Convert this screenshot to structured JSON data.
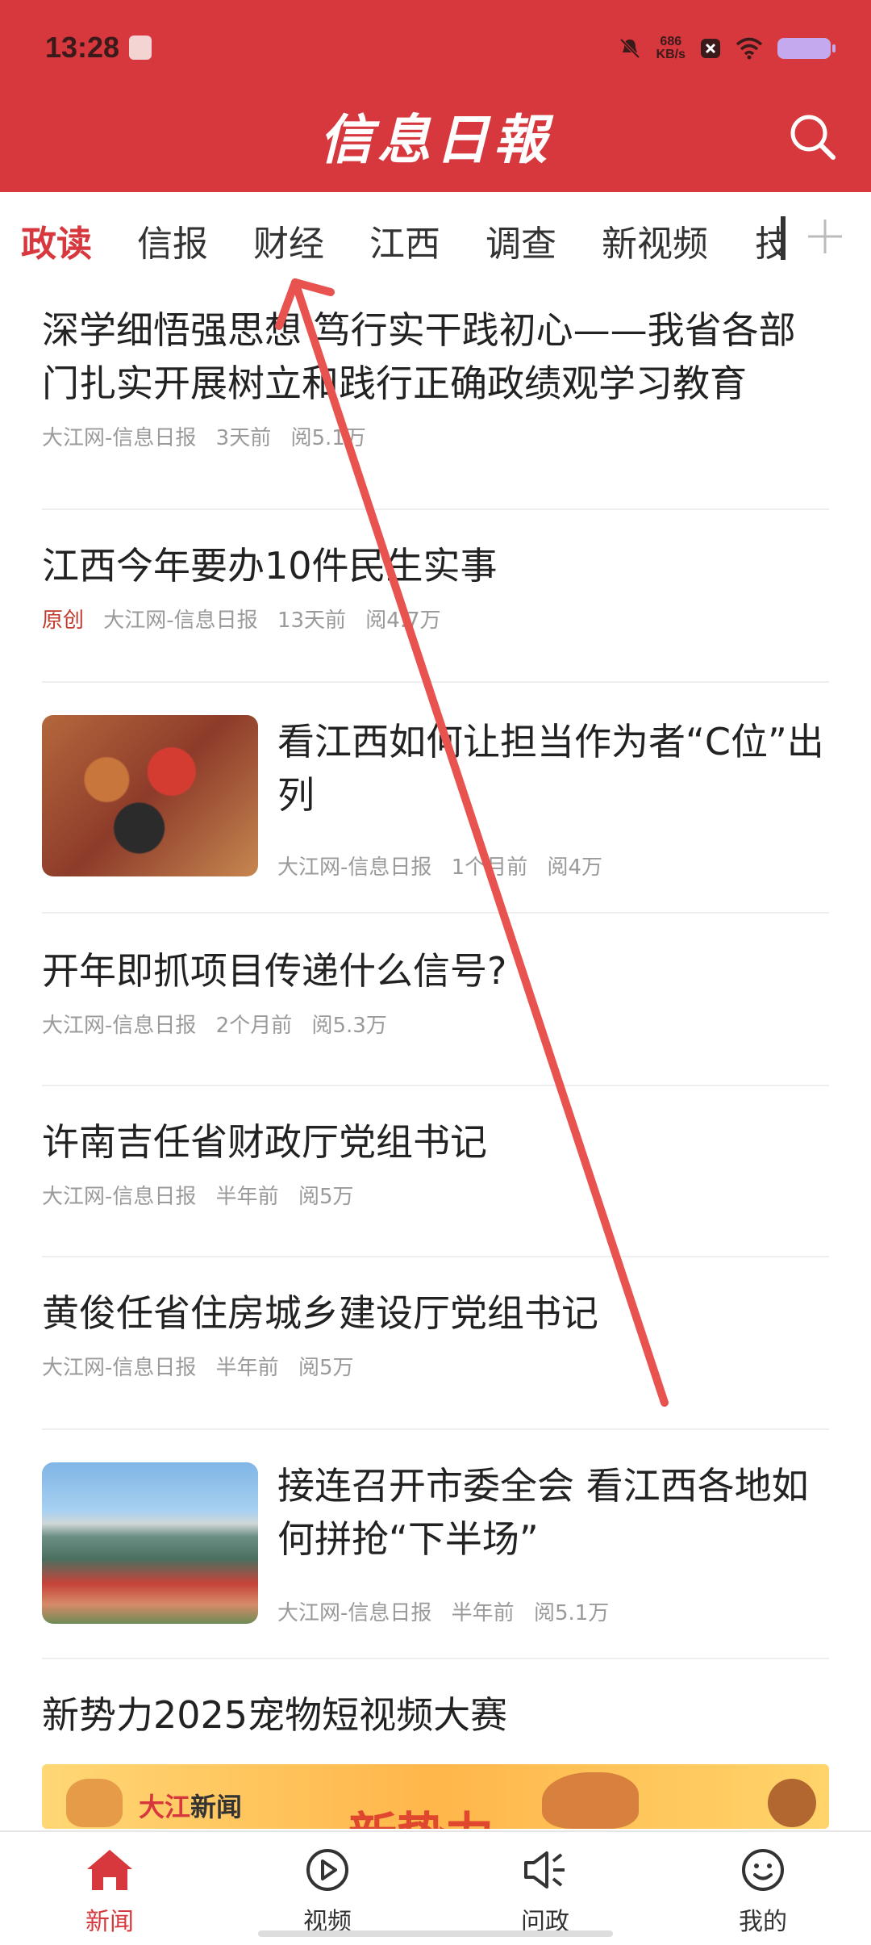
{
  "status": {
    "time": "13:28",
    "net_speed_value": "686",
    "net_speed_unit": "KB/s"
  },
  "masthead": {
    "title": "信息日報"
  },
  "tabs": [
    {
      "label": "政读",
      "active": true
    },
    {
      "label": "信报"
    },
    {
      "label": "财经"
    },
    {
      "label": "江西"
    },
    {
      "label": "调查"
    },
    {
      "label": "新视频"
    },
    {
      "label": "技"
    }
  ],
  "articles": [
    {
      "title": "深学细悟强思想 笃行实干践初心——我省各部门扎实开展树立和践行正确政绩观学习教育",
      "source": "大江网-信息日报",
      "time": "3天前",
      "reads": "阅5.1万"
    },
    {
      "tag": "原创",
      "title": "江西今年要办10件民生实事",
      "source": "大江网-信息日报",
      "time": "13天前",
      "reads": "阅4.7万"
    },
    {
      "title": "看江西如何让担当作为者“C位”出列",
      "source": "大江网-信息日报",
      "time": "1个月前",
      "reads": "阅4万"
    },
    {
      "title": "开年即抓项目传递什么信号?",
      "source": "大江网-信息日报",
      "time": "2个月前",
      "reads": "阅5.3万"
    },
    {
      "title": "许南吉任省财政厅党组书记",
      "source": "大江网-信息日报",
      "time": "半年前",
      "reads": "阅5万"
    },
    {
      "title": "黄俊任省住房城乡建设厅党组书记",
      "source": "大江网-信息日报",
      "time": "半年前",
      "reads": "阅5万"
    },
    {
      "title": "接连召开市委全会 看江西各地如何拼抢“下半场”",
      "source": "大江网-信息日报",
      "time": "半年前",
      "reads": "阅5.1万"
    },
    {
      "title": "新势力2025宠物短视频大赛"
    }
  ],
  "banner": {
    "logo_red": "大江",
    "logo_dark": "新闻",
    "headline": "新势力"
  },
  "bottom_nav": [
    {
      "label": "新闻",
      "icon": "home-icon",
      "active": true
    },
    {
      "label": "视频",
      "icon": "play-icon"
    },
    {
      "label": "问政",
      "icon": "megaphone-icon"
    },
    {
      "label": "我的",
      "icon": "smiley-icon"
    }
  ],
  "colors": {
    "brand_red": "#d6383d",
    "annotation_arrow": "#e8524f"
  }
}
